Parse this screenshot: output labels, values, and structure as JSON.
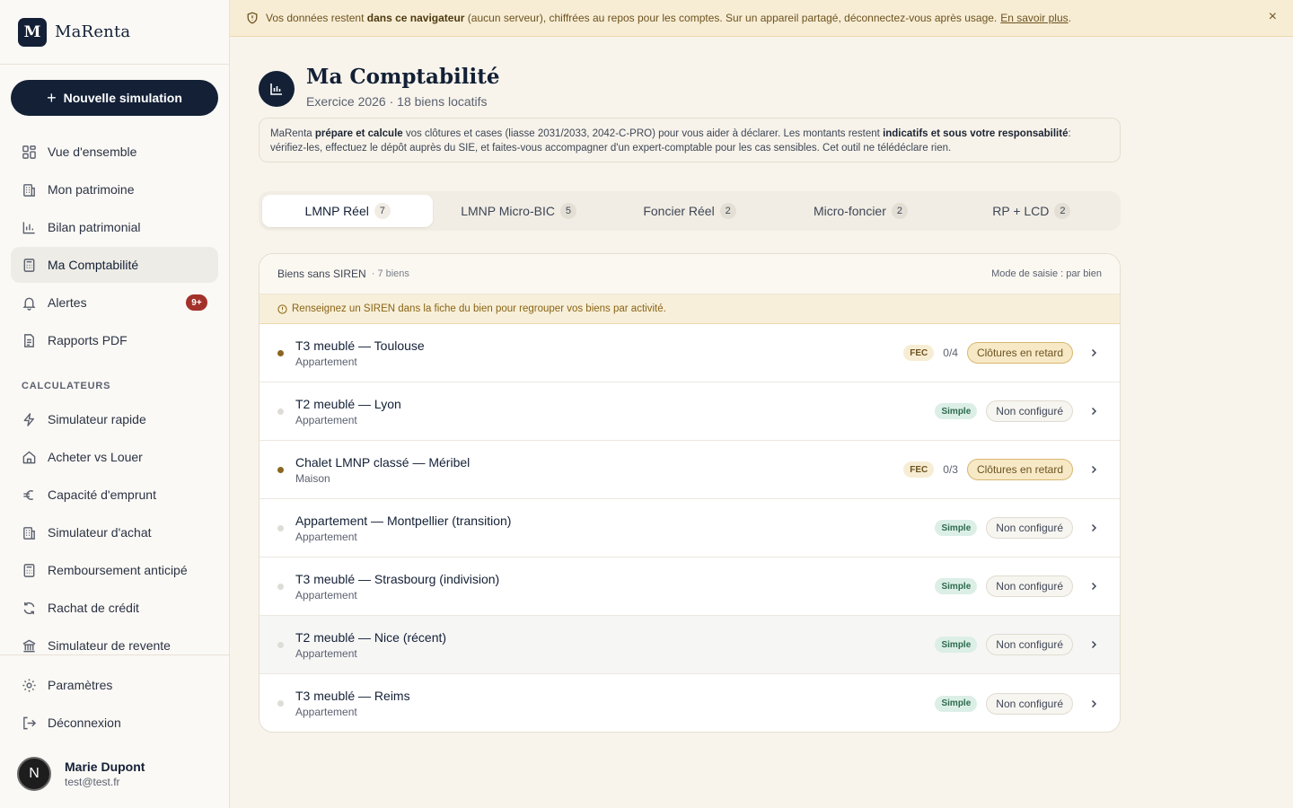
{
  "brand": {
    "logo_letter": "M",
    "name": "MaRenta"
  },
  "sidebar": {
    "new_simulation": "Nouvelle simulation",
    "items": [
      {
        "label": "Vue d'ensemble",
        "icon": "grid-icon"
      },
      {
        "label": "Mon patrimoine",
        "icon": "building-icon"
      },
      {
        "label": "Bilan patrimonial",
        "icon": "bar-chart-icon"
      },
      {
        "label": "Ma Comptabilité",
        "icon": "calculator-icon",
        "active": true
      },
      {
        "label": "Alertes",
        "icon": "bell-icon",
        "badge": "9+"
      },
      {
        "label": "Rapports PDF",
        "icon": "document-icon"
      }
    ],
    "section_label": "CALCULATEURS",
    "calculators": [
      {
        "label": "Simulateur rapide",
        "icon": "bolt-icon"
      },
      {
        "label": "Acheter vs Louer",
        "icon": "house-icon"
      },
      {
        "label": "Capacité d'emprunt",
        "icon": "euro-icon"
      },
      {
        "label": "Simulateur d'achat",
        "icon": "building-icon"
      },
      {
        "label": "Remboursement anticipé",
        "icon": "calculator-icon"
      },
      {
        "label": "Rachat de crédit",
        "icon": "refresh-icon"
      },
      {
        "label": "Simulateur de revente",
        "icon": "bank-icon"
      }
    ],
    "bottom": [
      {
        "label": "Paramètres",
        "icon": "gear-icon"
      },
      {
        "label": "Déconnexion",
        "icon": "logout-icon"
      }
    ],
    "user": {
      "initial": "N",
      "name": "Marie Dupont",
      "email": "test@test.fr"
    }
  },
  "banner": {
    "text_before": "Vos données restent ",
    "text_bold": "dans ce navigateur",
    "text_after": " (aucun serveur), chiffrées au repos pour les comptes. Sur un appareil partagé, déconnectez-vous après usage.",
    "link": "En savoir plus",
    "link_suffix": ".",
    "close": "×"
  },
  "header": {
    "title": "Ma Comptabilité",
    "subtitle": "Exercice 2026 · 18 biens locatifs"
  },
  "disclaimer": {
    "p1": "MaRenta ",
    "b1": "prépare et calcule",
    "p2": " vos clôtures et cases (liasse 2031/2033, 2042-C-PRO) pour vous aider à déclarer. Les montants restent ",
    "b2": "indicatifs et sous votre responsabilité",
    "p3": ": vérifiez-les, effectuez le dépôt auprès du SIE, et faites-vous accompagner d'un expert-comptable pour les cas sensibles. Cet outil ne télédéclare rien."
  },
  "tabs": [
    {
      "label": "LMNP Réel",
      "count": "7",
      "active": true
    },
    {
      "label": "LMNP Micro-BIC",
      "count": "5"
    },
    {
      "label": "Foncier Réel",
      "count": "2"
    },
    {
      "label": "Micro-foncier",
      "count": "2"
    },
    {
      "label": "RP + LCD",
      "count": "2"
    }
  ],
  "card": {
    "group": "Biens sans SIREN",
    "count": "· 7 biens",
    "mode": "Mode de saisie : par bien",
    "note": "Renseignez un SIREN dans la fiche du bien pour regrouper vos biens par activité."
  },
  "rows": [
    {
      "title": "T3 meublé — Toulouse",
      "type": "Appartement",
      "mode": "FEC",
      "progress": "0/4",
      "status": "Clôtures en retard",
      "late": true
    },
    {
      "title": "T2 meublé — Lyon",
      "type": "Appartement",
      "mode": "Simple",
      "progress": "",
      "status": "Non configuré",
      "late": false
    },
    {
      "title": "Chalet LMNP classé — Méribel",
      "type": "Maison",
      "mode": "FEC",
      "progress": "0/3",
      "status": "Clôtures en retard",
      "late": true
    },
    {
      "title": "Appartement — Montpellier (transition)",
      "type": "Appartement",
      "mode": "Simple",
      "progress": "",
      "status": "Non configuré",
      "late": false
    },
    {
      "title": "T3 meublé — Strasbourg (indivision)",
      "type": "Appartement",
      "mode": "Simple",
      "progress": "",
      "status": "Non configuré",
      "late": false
    },
    {
      "title": "T2 meublé — Nice (récent)",
      "type": "Appartement",
      "mode": "Simple",
      "progress": "",
      "status": "Non configuré",
      "late": false
    },
    {
      "title": "T3 meublé — Reims",
      "type": "Appartement",
      "mode": "Simple",
      "progress": "",
      "status": "Non configuré",
      "late": false
    }
  ]
}
